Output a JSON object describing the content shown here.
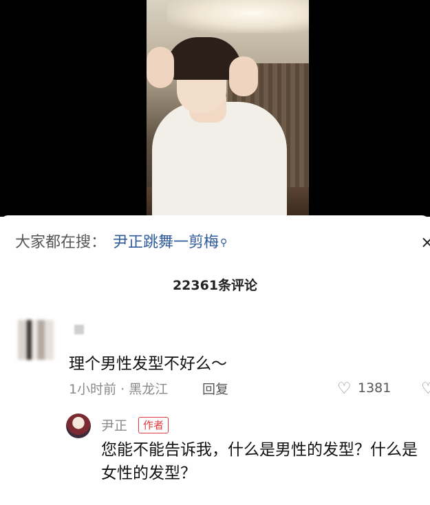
{
  "search": {
    "prefix": "大家都在搜：",
    "term": "尹正跳舞一剪梅",
    "icon": "search-icon",
    "close_glyph": "×"
  },
  "comments": {
    "count_label": "22361条评论"
  },
  "comment": {
    "text": "理个男性发型不好么～",
    "meta": "1小时前 · 黑龙江",
    "reply_label": "回复",
    "like_icon": "heart-outline-icon",
    "likes": "1381"
  },
  "reply": {
    "username": "尹正",
    "badge": "作者",
    "text": "您能不能告诉我，什么是男性的发型？什么是女性的发型？"
  },
  "colors": {
    "link": "#2f5a9b",
    "author_badge": "#e03a3e",
    "muted": "#8a8a8a"
  }
}
